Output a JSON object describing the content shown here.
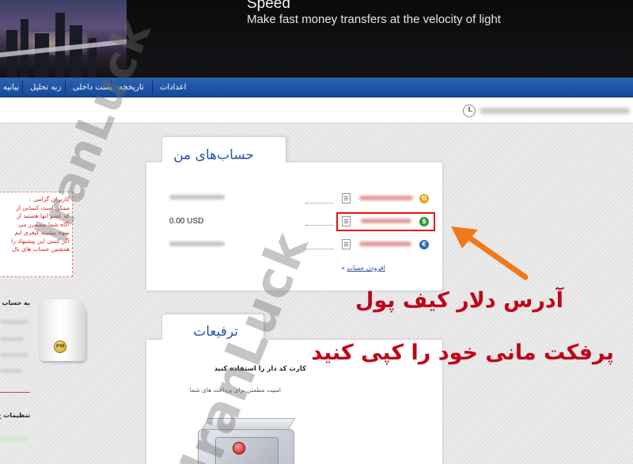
{
  "header": {
    "brand": "Speed",
    "tagline": "Make fast money transfers at the velocity of light"
  },
  "nav": {
    "items": [
      {
        "label": "اعدادات"
      },
      {
        "label": "تاريخچه"
      },
      {
        "label": "پست داخلی"
      },
      {
        "label": "زبه تحليل"
      },
      {
        "label": "بيانيه"
      }
    ]
  },
  "notice": {
    "lines": [
      "کاربران گرامی :",
      "ممکن است کسانی از",
      "که عضو انها هستید از",
      "اگاه شما مصمرر می",
      "سوه بیشینه کیفری ایم",
      "اگر کسی این پیشنهاد را",
      "همچنین حساب های بال"
    ]
  },
  "left": {
    "account_label": "به حساب",
    "pm_badge": "PM",
    "settings_label": "تنظیمات ج"
  },
  "accounts_panel": {
    "title": "حساب‌های من",
    "rows": [
      {
        "currency_icon": "gold-coin-icon",
        "currency_symbol": "G",
        "color": "#e0a81a",
        "balance": ""
      },
      {
        "currency_icon": "dollar-coin-icon",
        "currency_symbol": "$",
        "color": "#2f9a3a",
        "balance": "0.00 USD"
      },
      {
        "currency_icon": "euro-coin-icon",
        "currency_symbol": "€",
        "color": "#2f6fb3",
        "balance": ""
      }
    ],
    "add_account": "افزودن حساب",
    "add_account_suffix": "»"
  },
  "upgrades_panel": {
    "title": "ترفيعات",
    "subtitle": "کارت کد دار را استفاده کنيد",
    "description": "امنیت مطمئن برای پرداخت های شما"
  },
  "annotation": {
    "line1": "آدرس دلار کیف پول",
    "line2": "پرفکت مانی خود را کپی کنید",
    "color": "#c0061a"
  },
  "watermark": {
    "text": "IranLuck"
  },
  "colors": {
    "nav": "#1f55a8",
    "title_blue": "#2a56a4",
    "highlight": "#e11111",
    "arrow": "#f07a1a"
  }
}
